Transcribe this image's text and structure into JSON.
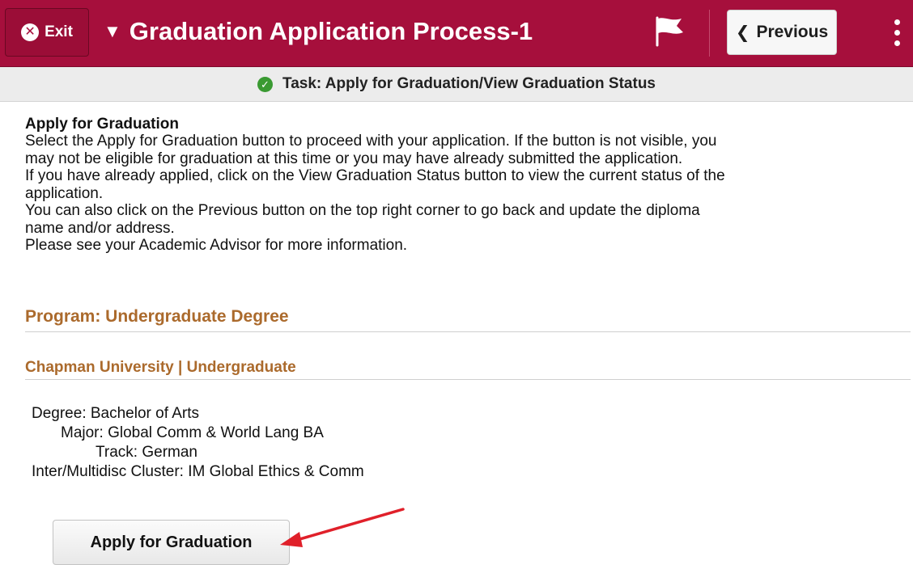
{
  "header": {
    "exit_label": "Exit",
    "exit_icon": "close-circle-icon",
    "title": "Graduation Application Process-1",
    "previous_label": "Previous",
    "brand_color": "#a60f3c"
  },
  "task": {
    "label": "Task: Apply for Graduation/View Graduation Status",
    "status_icon": "check-circle-icon",
    "status_color": "#3a9a32"
  },
  "intro": {
    "heading": "Apply for Graduation",
    "lines": [
      "Select the Apply for Graduation button to proceed with your application. If the button is not visible, you",
      "may not be eligible for graduation at this time or you may have already submitted the application.",
      "If you have already applied, click on the View Graduation Status button to view the current status of the",
      "application.",
      "You can also click on the Previous button on the top right corner to go back and update the diploma",
      "name and/or address.",
      "Please see your Academic Advisor for more information."
    ]
  },
  "program": {
    "title": "Program: Undergraduate Degree",
    "institution": "Chapman University | Undergraduate",
    "degree": "Degree: Bachelor of Arts",
    "major": "Major: Global Comm & World Lang BA",
    "track": "Track: German",
    "cluster": "Inter/Multidisc Cluster: IM Global Ethics & Comm",
    "accent_color": "#ab6a2c"
  },
  "actions": {
    "apply_label": "Apply for Graduation",
    "annotation_color": "#e0202a"
  }
}
